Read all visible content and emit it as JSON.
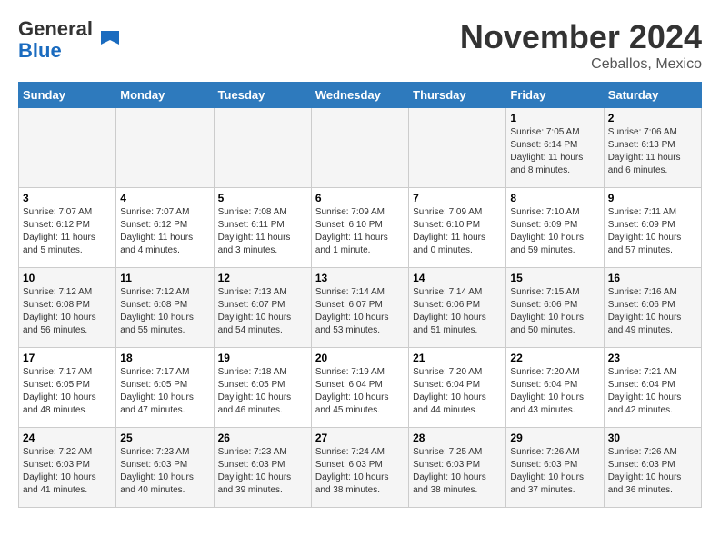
{
  "header": {
    "logo_general": "General",
    "logo_blue": "Blue",
    "month_title": "November 2024",
    "subtitle": "Ceballos, Mexico"
  },
  "calendar": {
    "days_of_week": [
      "Sunday",
      "Monday",
      "Tuesday",
      "Wednesday",
      "Thursday",
      "Friday",
      "Saturday"
    ],
    "weeks": [
      [
        {
          "day": "",
          "info": ""
        },
        {
          "day": "",
          "info": ""
        },
        {
          "day": "",
          "info": ""
        },
        {
          "day": "",
          "info": ""
        },
        {
          "day": "",
          "info": ""
        },
        {
          "day": "1",
          "info": "Sunrise: 7:05 AM\nSunset: 6:14 PM\nDaylight: 11 hours and 8 minutes."
        },
        {
          "day": "2",
          "info": "Sunrise: 7:06 AM\nSunset: 6:13 PM\nDaylight: 11 hours and 6 minutes."
        }
      ],
      [
        {
          "day": "3",
          "info": "Sunrise: 7:07 AM\nSunset: 6:12 PM\nDaylight: 11 hours and 5 minutes."
        },
        {
          "day": "4",
          "info": "Sunrise: 7:07 AM\nSunset: 6:12 PM\nDaylight: 11 hours and 4 minutes."
        },
        {
          "day": "5",
          "info": "Sunrise: 7:08 AM\nSunset: 6:11 PM\nDaylight: 11 hours and 3 minutes."
        },
        {
          "day": "6",
          "info": "Sunrise: 7:09 AM\nSunset: 6:10 PM\nDaylight: 11 hours and 1 minute."
        },
        {
          "day": "7",
          "info": "Sunrise: 7:09 AM\nSunset: 6:10 PM\nDaylight: 11 hours and 0 minutes."
        },
        {
          "day": "8",
          "info": "Sunrise: 7:10 AM\nSunset: 6:09 PM\nDaylight: 10 hours and 59 minutes."
        },
        {
          "day": "9",
          "info": "Sunrise: 7:11 AM\nSunset: 6:09 PM\nDaylight: 10 hours and 57 minutes."
        }
      ],
      [
        {
          "day": "10",
          "info": "Sunrise: 7:12 AM\nSunset: 6:08 PM\nDaylight: 10 hours and 56 minutes."
        },
        {
          "day": "11",
          "info": "Sunrise: 7:12 AM\nSunset: 6:08 PM\nDaylight: 10 hours and 55 minutes."
        },
        {
          "day": "12",
          "info": "Sunrise: 7:13 AM\nSunset: 6:07 PM\nDaylight: 10 hours and 54 minutes."
        },
        {
          "day": "13",
          "info": "Sunrise: 7:14 AM\nSunset: 6:07 PM\nDaylight: 10 hours and 53 minutes."
        },
        {
          "day": "14",
          "info": "Sunrise: 7:14 AM\nSunset: 6:06 PM\nDaylight: 10 hours and 51 minutes."
        },
        {
          "day": "15",
          "info": "Sunrise: 7:15 AM\nSunset: 6:06 PM\nDaylight: 10 hours and 50 minutes."
        },
        {
          "day": "16",
          "info": "Sunrise: 7:16 AM\nSunset: 6:06 PM\nDaylight: 10 hours and 49 minutes."
        }
      ],
      [
        {
          "day": "17",
          "info": "Sunrise: 7:17 AM\nSunset: 6:05 PM\nDaylight: 10 hours and 48 minutes."
        },
        {
          "day": "18",
          "info": "Sunrise: 7:17 AM\nSunset: 6:05 PM\nDaylight: 10 hours and 47 minutes."
        },
        {
          "day": "19",
          "info": "Sunrise: 7:18 AM\nSunset: 6:05 PM\nDaylight: 10 hours and 46 minutes."
        },
        {
          "day": "20",
          "info": "Sunrise: 7:19 AM\nSunset: 6:04 PM\nDaylight: 10 hours and 45 minutes."
        },
        {
          "day": "21",
          "info": "Sunrise: 7:20 AM\nSunset: 6:04 PM\nDaylight: 10 hours and 44 minutes."
        },
        {
          "day": "22",
          "info": "Sunrise: 7:20 AM\nSunset: 6:04 PM\nDaylight: 10 hours and 43 minutes."
        },
        {
          "day": "23",
          "info": "Sunrise: 7:21 AM\nSunset: 6:04 PM\nDaylight: 10 hours and 42 minutes."
        }
      ],
      [
        {
          "day": "24",
          "info": "Sunrise: 7:22 AM\nSunset: 6:03 PM\nDaylight: 10 hours and 41 minutes."
        },
        {
          "day": "25",
          "info": "Sunrise: 7:23 AM\nSunset: 6:03 PM\nDaylight: 10 hours and 40 minutes."
        },
        {
          "day": "26",
          "info": "Sunrise: 7:23 AM\nSunset: 6:03 PM\nDaylight: 10 hours and 39 minutes."
        },
        {
          "day": "27",
          "info": "Sunrise: 7:24 AM\nSunset: 6:03 PM\nDaylight: 10 hours and 38 minutes."
        },
        {
          "day": "28",
          "info": "Sunrise: 7:25 AM\nSunset: 6:03 PM\nDaylight: 10 hours and 38 minutes."
        },
        {
          "day": "29",
          "info": "Sunrise: 7:26 AM\nSunset: 6:03 PM\nDaylight: 10 hours and 37 minutes."
        },
        {
          "day": "30",
          "info": "Sunrise: 7:26 AM\nSunset: 6:03 PM\nDaylight: 10 hours and 36 minutes."
        }
      ]
    ]
  }
}
